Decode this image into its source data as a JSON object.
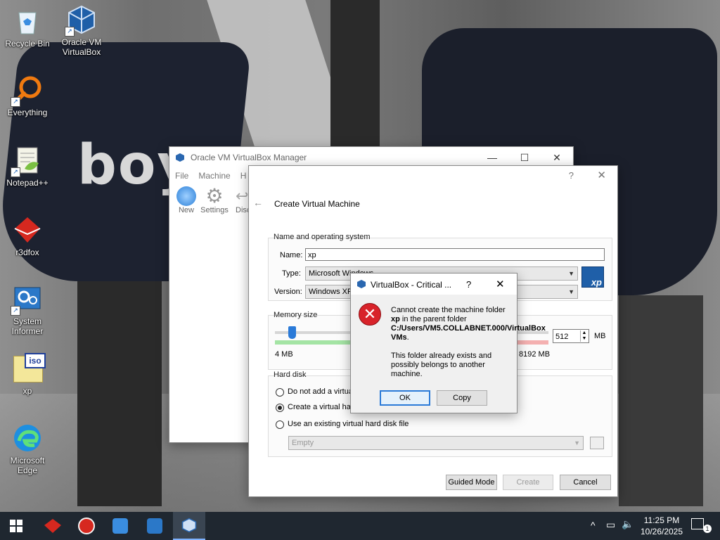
{
  "desktop": {
    "icons": [
      {
        "label": "Recycle Bin",
        "icon": "recycle-bin-icon"
      },
      {
        "label": "Oracle VM VirtualBox",
        "icon": "virtualbox-icon"
      },
      {
        "label": "Everything",
        "icon": "everything-search-icon"
      },
      {
        "label": "Notepad++",
        "icon": "notepadpp-icon"
      },
      {
        "label": "r3dfox",
        "icon": "r3dfox-icon"
      },
      {
        "label": "System Informer",
        "icon": "system-informer-icon"
      },
      {
        "label": "xp",
        "icon": "iso-file-icon",
        "badge": "iso"
      },
      {
        "label": "Microsoft Edge",
        "icon": "edge-icon"
      }
    ],
    "wallpaper_text": "boy"
  },
  "manager": {
    "title": "Oracle VM VirtualBox Manager",
    "menu": [
      "File",
      "Machine",
      "H"
    ],
    "toolbar": [
      "New",
      "Settings",
      "Disc"
    ]
  },
  "wizard": {
    "title": "Create Virtual Machine",
    "help": "?",
    "name_os": {
      "legend": "Name and operating system",
      "name_label": "Name:",
      "name_value": "xp",
      "type_label": "Type:",
      "type_value": "Microsoft Windows",
      "version_label": "Version:",
      "version_value": "Windows XP",
      "os_badge": "xp"
    },
    "memory": {
      "legend": "Memory size",
      "min_label": "4 MB",
      "max_label": "8192 MB",
      "value": "512",
      "unit": "MB",
      "fraction": 0.0625
    },
    "hard_disk": {
      "legend": "Hard disk",
      "options": [
        {
          "label": "Do not add a virtual hard disk",
          "selected": false
        },
        {
          "label": "Create a virtual hard disk now",
          "selected": true
        },
        {
          "label": "Use an existing virtual hard disk file",
          "selected": false
        }
      ],
      "existing_value": "Empty"
    },
    "buttons": {
      "guided": "Guided Mode",
      "create": "Create",
      "cancel": "Cancel"
    }
  },
  "error_dialog": {
    "title": "VirtualBox - Critical ...",
    "help": "?",
    "message_pre": "Cannot create the machine folder ",
    "folder": "xp",
    "message_mid": " in the parent folder ",
    "path": "C:/Users/VM5.COLLABNET.000/VirtualBox VMs",
    "message_end": ".",
    "detail": "This folder already exists and possibly belongs to another machine.",
    "ok": "OK",
    "copy": "Copy"
  },
  "taskbar": {
    "time": "11:25 PM",
    "date": "10/26/2025",
    "notification_count": "1"
  }
}
